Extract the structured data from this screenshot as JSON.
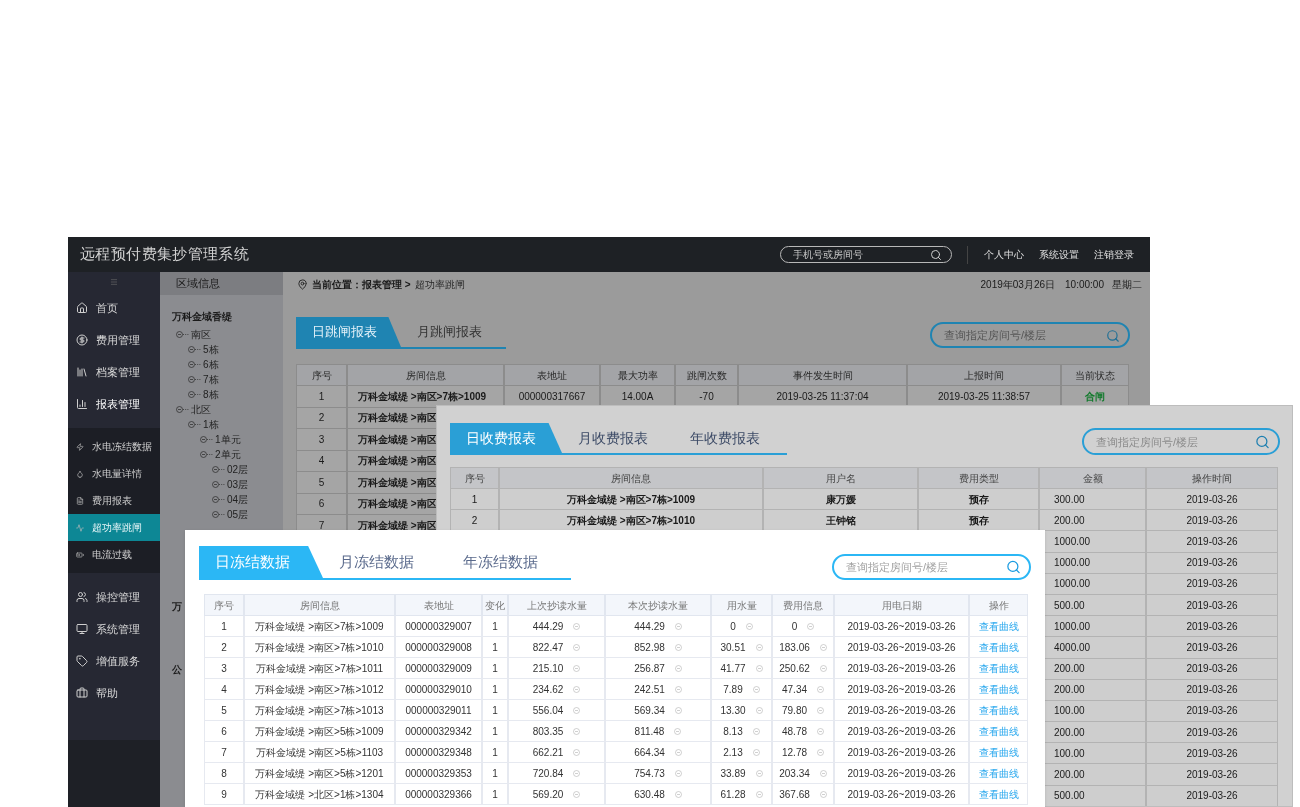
{
  "app": {
    "title": "远程预付费集抄管理系统",
    "search": {
      "placeholder": "手机号或房间号"
    },
    "header_links": [
      "个人中心",
      "系统设置",
      "注销登录"
    ]
  },
  "sidebar": {
    "items": [
      {
        "label": "首页"
      },
      {
        "label": "费用管理"
      },
      {
        "label": "档案管理"
      },
      {
        "label": "报表管理",
        "expanded": true,
        "children": [
          {
            "label": "水电冻结数据",
            "selected": false
          },
          {
            "label": "水电量详情",
            "selected": false
          },
          {
            "label": "费用报表",
            "selected": false
          },
          {
            "label": "超功率跳闸",
            "selected": true
          },
          {
            "label": "电流过载",
            "selected": false
          }
        ]
      },
      {
        "label": "操控管理"
      },
      {
        "label": "系统管理"
      },
      {
        "label": "增值服务"
      },
      {
        "label": "帮助"
      }
    ]
  },
  "area_panel": {
    "title": "区域信息",
    "tree": [
      {
        "label": "万科金域香缇",
        "children": [
          {
            "label": "南区",
            "children": [
              {
                "label": "5栋"
              },
              {
                "label": "6栋"
              },
              {
                "label": "7栋"
              },
              {
                "label": "8栋"
              }
            ]
          },
          {
            "label": "北区",
            "children": [
              {
                "label": "1栋",
                "children": [
                  {
                    "label": "1单元"
                  },
                  {
                    "label": "2单元",
                    "children": [
                      {
                        "label": "02层"
                      },
                      {
                        "label": "03层"
                      },
                      {
                        "label": "04层"
                      },
                      {
                        "label": "05层"
                      }
                    ]
                  }
                ]
              }
            ]
          }
        ]
      },
      {
        "label": "万"
      },
      {
        "label": "公"
      }
    ]
  },
  "breadcrumb": {
    "path": "当前位置：报表管理 >",
    "current": "超功率跳闸"
  },
  "datetime": {
    "date": "2019年03月26日",
    "time": "10:00:00",
    "weekday": "星期二"
  },
  "trip_report": {
    "tabs": [
      {
        "label": "日跳闸报表",
        "selected": true
      },
      {
        "label": "月跳闸报表",
        "selected": false
      }
    ],
    "search": {
      "placeholder": "查询指定房间号/楼层"
    },
    "columns": [
      "序号",
      "房间信息",
      "表地址",
      "最大功率",
      "跳闸次数",
      "事件发生时间",
      "上报时间",
      "当前状态"
    ],
    "rows": [
      [
        "1",
        "万科金域缇 >南区>7栋>1009",
        "000000317667",
        "14.00A",
        "-70",
        "2019-03-25  11:37:04",
        "2019-03-25  11:38:57",
        "合闸"
      ],
      [
        "2",
        "万科金域缇 >南区"
      ],
      [
        "3",
        "万科金域缇 >南区"
      ],
      [
        "4",
        "万科金域缇 >南区"
      ],
      [
        "5",
        "万科金域缇 >南区"
      ],
      [
        "6",
        "万科金域缇 >南区"
      ],
      [
        "7",
        "万科金域缇 >南区"
      ]
    ]
  },
  "fee_report": {
    "tabs": [
      {
        "label": "日收费报表",
        "selected": true
      },
      {
        "label": "月收费报表",
        "selected": false
      },
      {
        "label": "年收费报表",
        "selected": false
      }
    ],
    "search": {
      "placeholder": "查询指定房间号/楼层"
    },
    "columns": [
      "序号",
      "房间信息",
      "用户名",
      "费用类型",
      "金额",
      "操作时间"
    ],
    "rows": [
      {
        "no": "1",
        "room": "万科金域缇 >南区>7栋>1009",
        "user": "康万媛",
        "type": "预存",
        "amount": "300.00",
        "time": "2019-03-26"
      },
      {
        "no": "2",
        "room": "万科金域缇 >南区>7栋>1010",
        "user": "王钟铭",
        "type": "预存",
        "amount": "200.00",
        "time": "2019-03-26"
      },
      {
        "amount": "1000.00",
        "time": "2019-03-26"
      },
      {
        "amount": "1000.00",
        "time": "2019-03-26"
      },
      {
        "amount": "1000.00",
        "time": "2019-03-26"
      },
      {
        "amount": "500.00",
        "time": "2019-03-26"
      },
      {
        "amount": "1000.00",
        "time": "2019-03-26"
      },
      {
        "amount": "4000.00",
        "time": "2019-03-26"
      },
      {
        "amount": "200.00",
        "time": "2019-03-26"
      },
      {
        "amount": "200.00",
        "time": "2019-03-26"
      },
      {
        "amount": "100.00",
        "time": "2019-03-26"
      },
      {
        "amount": "200.00",
        "time": "2019-03-26"
      },
      {
        "amount": "100.00",
        "time": "2019-03-26"
      },
      {
        "amount": "200.00",
        "time": "2019-03-26"
      },
      {
        "amount": "500.00",
        "time": "2019-03-26"
      }
    ]
  },
  "freeze_report": {
    "tabs": [
      {
        "label": "日冻结数据",
        "selected": true
      },
      {
        "label": "月冻结数据",
        "selected": false
      },
      {
        "label": "年冻结数据",
        "selected": false
      }
    ],
    "search": {
      "placeholder": "查询指定房间号/楼层"
    },
    "columns": [
      "序号",
      "房间信息",
      "表地址",
      "变化",
      "上次抄读水量",
      "本次抄读水量",
      "用水量",
      "费用信息",
      "用电日期",
      "操作"
    ],
    "rows": [
      [
        "1",
        "万科金域缇 >南区>7栋>1009",
        "000000329007",
        "1",
        "444.29",
        "444.29",
        "0",
        "0",
        "2019-03-26~2019-03-26",
        "查看曲线"
      ],
      [
        "2",
        "万科金域缇 >南区>7栋>1010",
        "000000329008",
        "1",
        "822.47",
        "852.98",
        "30.51",
        "183.06",
        "2019-03-26~2019-03-26",
        "查看曲线"
      ],
      [
        "3",
        "万科金域缇 >南区>7栋>1011",
        "000000329009",
        "1",
        "215.10",
        "256.87",
        "41.77",
        "250.62",
        "2019-03-26~2019-03-26",
        "查看曲线"
      ],
      [
        "4",
        "万科金域缇 >南区>7栋>1012",
        "000000329010",
        "1",
        "234.62",
        "242.51",
        "7.89",
        "47.34",
        "2019-03-26~2019-03-26",
        "查看曲线"
      ],
      [
        "5",
        "万科金域缇 >南区>7栋>1013",
        "000000329011",
        "1",
        "556.04",
        "569.34",
        "13.30",
        "79.80",
        "2019-03-26~2019-03-26",
        "查看曲线"
      ],
      [
        "6",
        "万科金域缇 >南区>5栋>1009",
        "000000329342",
        "1",
        "803.35",
        "811.48",
        "8.13",
        "48.78",
        "2019-03-26~2019-03-26",
        "查看曲线"
      ],
      [
        "7",
        "万科金域缇 >南区>5栋>1103",
        "000000329348",
        "1",
        "662.21",
        "664.34",
        "2.13",
        "12.78",
        "2019-03-26~2019-03-26",
        "查看曲线"
      ],
      [
        "8",
        "万科金域缇 >南区>5栋>1201",
        "000000329353",
        "1",
        "720.84",
        "754.73",
        "33.89",
        "203.34",
        "2019-03-26~2019-03-26",
        "查看曲线"
      ],
      [
        "9",
        "万科金域缇 >北区>1栋>1304",
        "000000329366",
        "1",
        "569.20",
        "630.48",
        "61.28",
        "367.68",
        "2019-03-26~2019-03-26",
        "查看曲线"
      ]
    ]
  }
}
